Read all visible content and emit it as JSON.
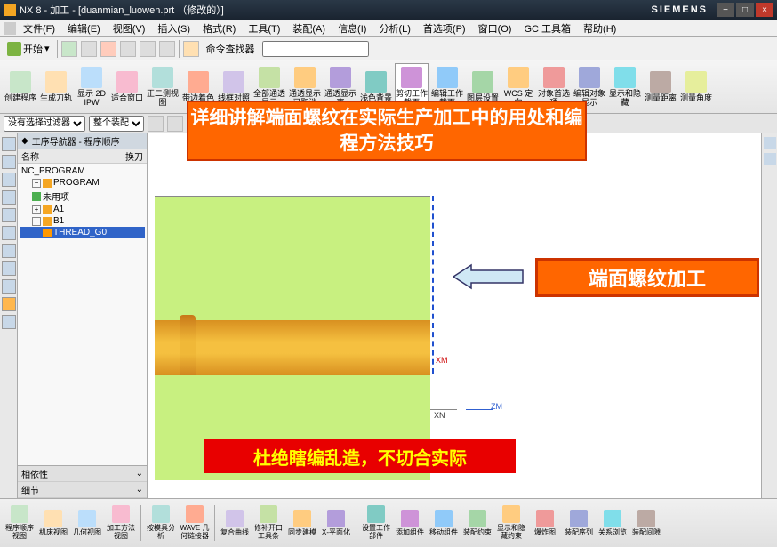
{
  "title": "NX 8 - 加工 - [duanmian_luowen.prt （修改的）]",
  "brand": "SIEMENS",
  "menu": {
    "file": "文件(F)",
    "edit": "编辑(E)",
    "view": "视图(V)",
    "insert": "插入(S)",
    "format": "格式(R)",
    "tools": "工具(T)",
    "assembly": "装配(A)",
    "info": "信息(I)",
    "analysis": "分析(L)",
    "preferences": "首选项(P)",
    "window": "窗口(O)",
    "gc": "GC 工具箱",
    "help": "帮助(H)"
  },
  "toolbar": {
    "start": "开始",
    "cmdfinder": "命令查找器"
  },
  "ribbon": {
    "r0": "创建程序",
    "r1": "生成刀轨",
    "r2": "显示 2D IPW",
    "r3": "适合窗口",
    "r4": "正二测视图",
    "r5": "带边着色",
    "r6": "线框对照",
    "r7": "全部通透显示",
    "r8": "通透显示已取消",
    "r9": "通透显示壳",
    "r10": "浅色背景",
    "r11": "剪切工作截面",
    "r12": "编辑工作截面",
    "r13": "图层设置",
    "r14": "WCS 定向",
    "r15": "对象首选项",
    "r16": "编辑对象显示",
    "r17": "显示和隐藏",
    "r18": "测量距离",
    "r19": "测量角度"
  },
  "filter": {
    "label1": "没有选择过滤器",
    "label2": "整个装配"
  },
  "nav": {
    "title": "工序导航器 - 程序顺序",
    "col1": "名称",
    "col2": "换刀",
    "root": "NC_PROGRAM",
    "t1": "PROGRAM",
    "t2": "未用项",
    "t3": "A1",
    "t4": "B1",
    "t5": "THREAD_G0",
    "dep": "相依性",
    "detail": "细节"
  },
  "viewport": {
    "xm": "XM",
    "xn": "XN",
    "zm": "ZM"
  },
  "overlays": {
    "o1": "详细讲解端面螺纹在实际生产加工中的用处和编程方法技巧",
    "o2": "端面螺纹加工",
    "o3": "杜绝瞎编乱造，不切合实际"
  },
  "bottom": {
    "b0": "程序顺序视图",
    "b1": "机床视图",
    "b2": "几何视图",
    "b3": "加工方法视图",
    "b4": "按模具分析",
    "b5": "WAVE 几何链接器",
    "b6": "复合曲线",
    "b7": "修补开口工具条",
    "b8": "同步建模",
    "b9": "X-平面化",
    "b10": "设置工作部件",
    "b11": "添加组件",
    "b12": "移动组件",
    "b13": "装配约束",
    "b14": "显示和隐藏约束",
    "b15": "爆炸图",
    "b16": "装配序列",
    "b17": "关系浏览",
    "b18": "装配间隙"
  },
  "colors": {
    "c0": "#7cb342",
    "c1": "#f5a623",
    "c2": "#42a5f5",
    "c3": "#ab47bc",
    "c4": "#26c6da",
    "c5": "#ef5350",
    "c6": "#ffa726",
    "c7": "#66bb6a",
    "c8": "#8d6e63",
    "c9": "#5c6bc0"
  }
}
